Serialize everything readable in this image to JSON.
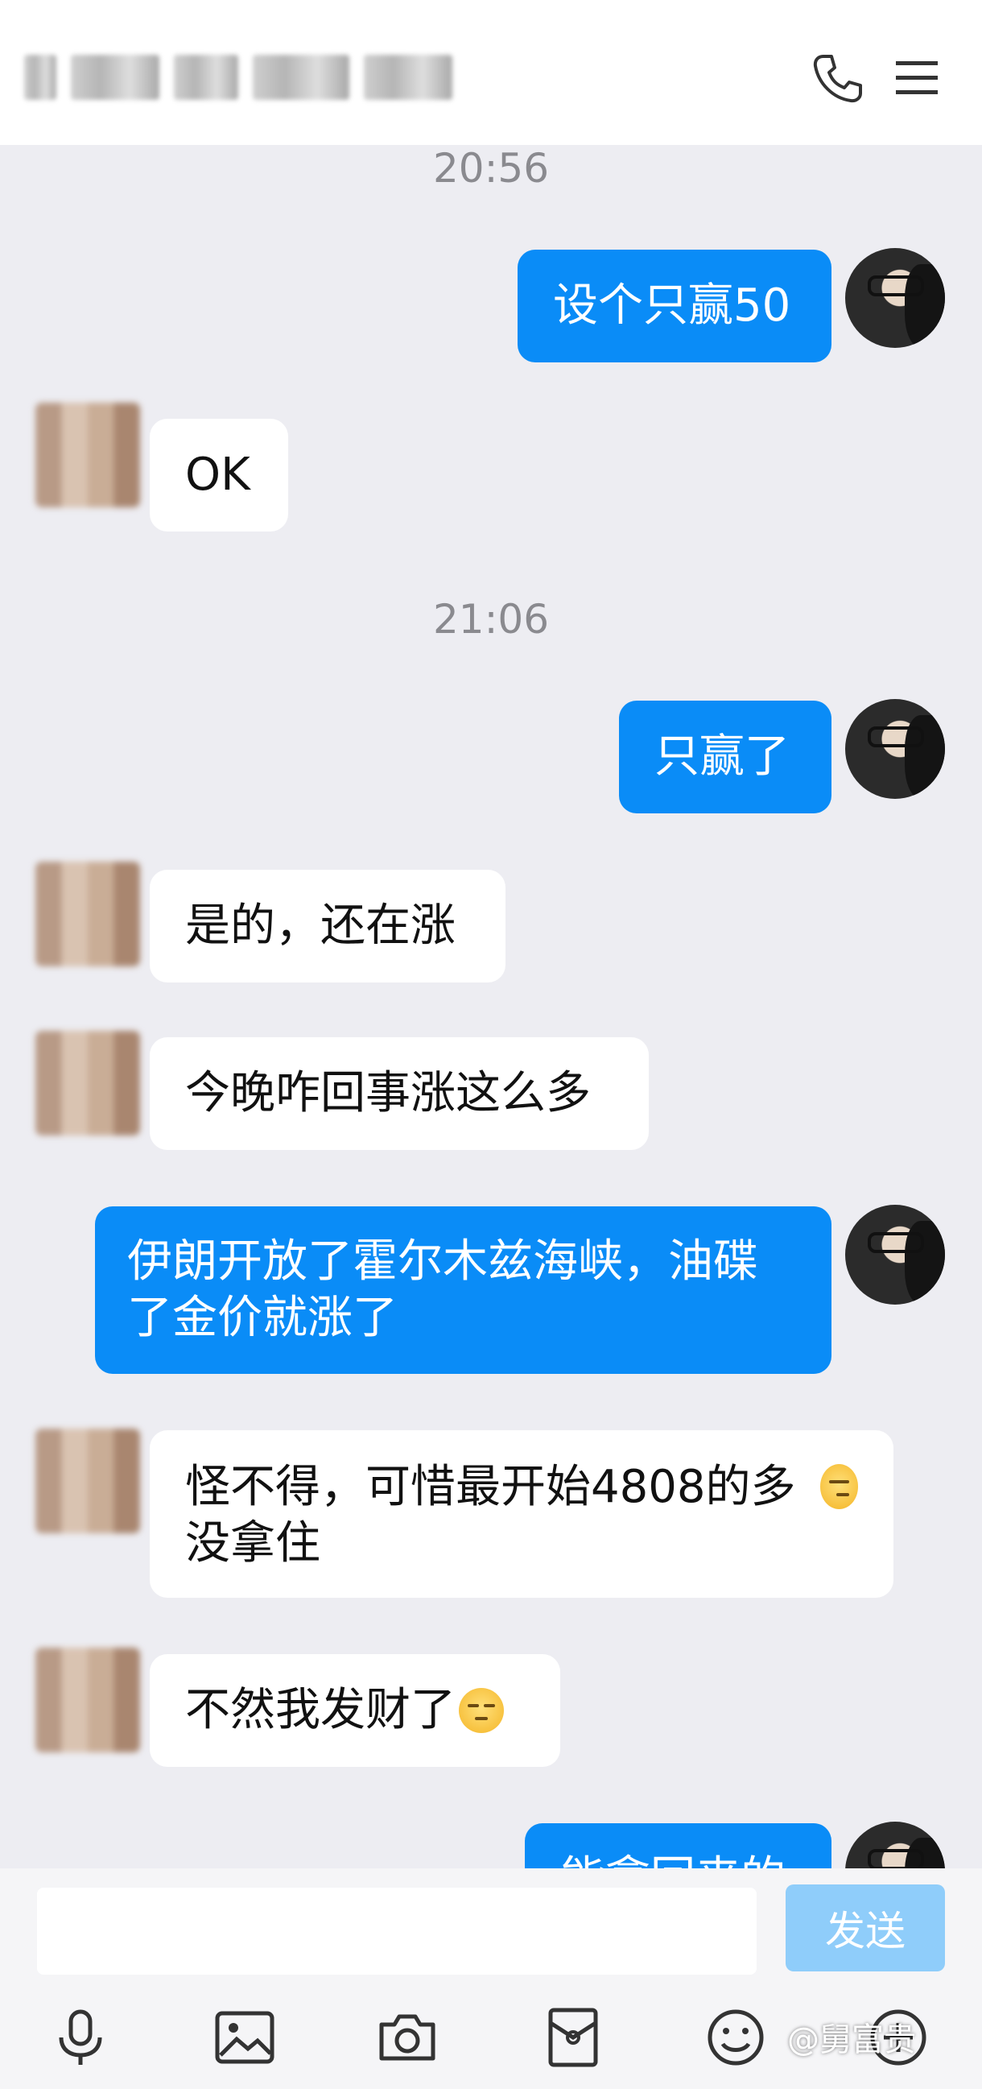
{
  "header": {
    "phone_icon": "phone-icon",
    "menu_icon": "menu-icon"
  },
  "messages": {
    "time1": "20:56",
    "m1": "设个只赢50",
    "m2": "OK",
    "time2": "21:06",
    "m3": "只赢了",
    "m4": "是的，还在涨",
    "m5": "今晚咋回事涨这么多",
    "m6": "伊朗开放了霍尔木兹海峡，油碟了金价就涨了",
    "m7": "怪不得，可惜最开始4808的多没拿住",
    "m8": "不然我发财了",
    "m9_partial": "能拿回来的"
  },
  "input": {
    "value": "",
    "send_label": "发送"
  },
  "toolbar": {
    "icons": [
      "mic-icon",
      "image-icon",
      "camera-icon",
      "red-packet-icon",
      "emoji-icon",
      "plus-icon"
    ]
  },
  "watermark": "@舅富贵",
  "colors": {
    "sent_bubble": "#0a8cf7",
    "received_bubble": "#ffffff",
    "background": "#ededf2",
    "send_button": "#8fcdfa"
  }
}
